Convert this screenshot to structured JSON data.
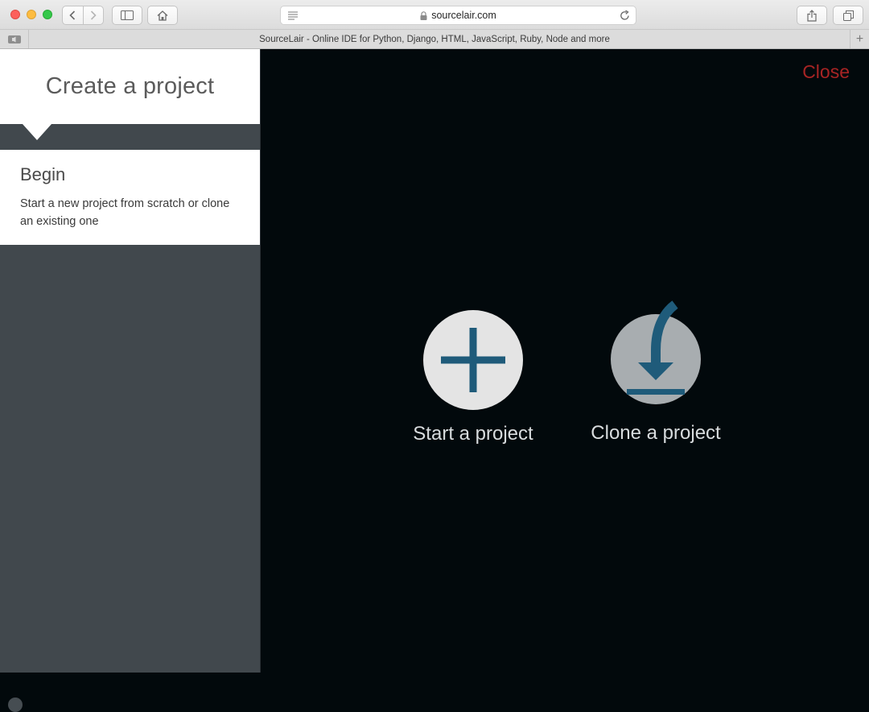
{
  "browser": {
    "url": "sourcelair.com",
    "tab_title": "SourceLair - Online IDE for Python, Django, HTML, JavaScript, Ruby, Node and more",
    "new_tab_label": "+"
  },
  "sidebar": {
    "title": "Create a project",
    "step": {
      "title": "Begin",
      "description": "Start a new project from scratch or clone an existing one"
    }
  },
  "main": {
    "close_label": "Close",
    "actions": [
      {
        "label": "Start a project",
        "icon": "plus-icon"
      },
      {
        "label": "Clone a project",
        "icon": "download-icon"
      }
    ]
  },
  "colors": {
    "background": "#02090c",
    "sidebar": "#41484d",
    "accent_icon": "#1f5b7a",
    "close": "#a82424"
  }
}
